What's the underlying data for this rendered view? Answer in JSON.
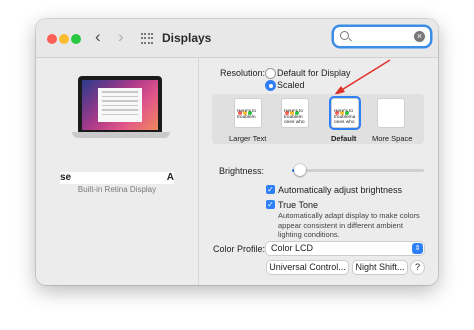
{
  "window": {
    "title": "Displays"
  },
  "search": {
    "value": "",
    "placeholder": ""
  },
  "display": {
    "name_start": "se",
    "name_end": "A",
    "subtitle": "Built-in Retina Display"
  },
  "resolution": {
    "label": "Resolution:",
    "options": [
      "Default for Display",
      "Scaled"
    ],
    "selected": "Scaled"
  },
  "scales": [
    {
      "label": "Larger Text",
      "sample": "Here's to\ntroublem"
    },
    {
      "label": "",
      "sample": "Here's to\ntroublem\nones who"
    },
    {
      "label": "Default",
      "sample": "Here's to\ntroublema\nones who"
    },
    {
      "label": "More Space",
      "sample": ""
    }
  ],
  "brightness": {
    "label": "Brightness:",
    "level": 0.06
  },
  "auto_brightness": {
    "label": "Automatically adjust brightness",
    "checked": true
  },
  "true_tone": {
    "label": "True Tone",
    "checked": true,
    "description": "Automatically adapt display to make colors appear consistent in different ambient lighting conditions."
  },
  "color_profile": {
    "label": "Color Profile:",
    "value": "Color LCD"
  },
  "buttons": {
    "universal_control": "Universal Control...",
    "night_shift": "Night Shift...",
    "help": "?"
  },
  "colors": {
    "accent": "#2f7ff6",
    "annotation_arrow": "#e0302a"
  }
}
